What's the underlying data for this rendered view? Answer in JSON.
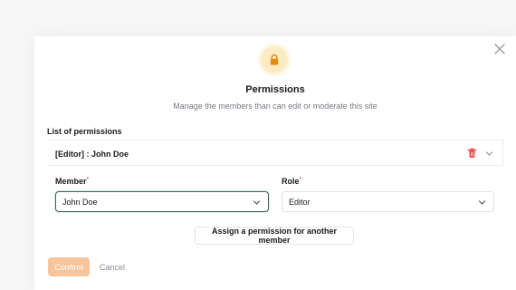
{
  "dialog": {
    "title": "Permissions",
    "subtitle": "Manage the members than can edit or moderate this site",
    "list_label": "List of permissions",
    "icons": {
      "header": "lock-icon",
      "close": "close-icon"
    }
  },
  "permission": {
    "title": "[Editor] : John Doe",
    "member_label": "Member",
    "member_value": "John Doe",
    "role_label": "Role",
    "role_value": "Editor",
    "required_mark": "*",
    "icons": {
      "delete": "trash-icon",
      "toggle": "chevron-down-icon"
    }
  },
  "actions": {
    "assign_label": "Assign a permission for another member",
    "confirm_label": "Confirm",
    "cancel_label": "Cancel"
  },
  "colors": {
    "accent": "#f7a35c",
    "confirm_disabled": "#f9c49a",
    "lock_bg": "#fdebc4",
    "lock_icon": "#e8890c",
    "delete_red": "#e5484d",
    "focus_green": "#2f6e5c"
  }
}
